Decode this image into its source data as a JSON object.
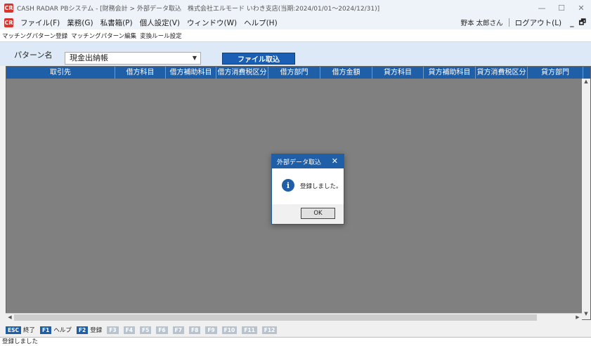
{
  "window": {
    "title": "CASH RADAR PBシステム - [財務会計 > 外部データ取込　株式会社エルモード いわき支店(当期:2024/01/01～2024/12/31)]",
    "logo": "CR",
    "controls": {
      "minimize": "—",
      "maximize": "☐",
      "close": "✕"
    }
  },
  "menu": {
    "items": [
      "ファイル(F)",
      "業務(G)",
      "私書箱(P)",
      "個人設定(V)",
      "ウィンドウ(W)",
      "ヘルプ(H)"
    ],
    "user": "野本 太郎さん",
    "logout": "ログアウト(L)",
    "mdi": {
      "minimize": "_",
      "restore": "🗗"
    }
  },
  "subtabs": [
    "マッチングパターン登録",
    "マッチングパターン編集",
    "変換ルール設定"
  ],
  "pattern": {
    "label": "パターン名",
    "selected": "現金出納帳",
    "import_button": "ファイル取込"
  },
  "grid": {
    "columns": [
      "取引先",
      "借方科目",
      "借方補助科目",
      "借方消費税区分",
      "借方部門",
      "借方金額",
      "貸方科目",
      "貸方補助科目",
      "貸方消費税区分",
      "貸方部門"
    ]
  },
  "dialog": {
    "title": "外部データ取込",
    "message": "登録しました。",
    "ok": "OK"
  },
  "fkeys": [
    {
      "key": "ESC",
      "label": "終了",
      "active": true
    },
    {
      "key": "F1",
      "label": "ヘルプ",
      "active": true
    },
    {
      "key": "F2",
      "label": "登録",
      "active": true
    },
    {
      "key": "F3",
      "label": "",
      "active": false
    },
    {
      "key": "F4",
      "label": "",
      "active": false
    },
    {
      "key": "F5",
      "label": "",
      "active": false
    },
    {
      "key": "F6",
      "label": "",
      "active": false
    },
    {
      "key": "F7",
      "label": "",
      "active": false
    },
    {
      "key": "F8",
      "label": "",
      "active": false
    },
    {
      "key": "F9",
      "label": "",
      "active": false
    },
    {
      "key": "F10",
      "label": "",
      "active": false
    },
    {
      "key": "F11",
      "label": "",
      "active": false
    },
    {
      "key": "F12",
      "label": "",
      "active": false
    }
  ],
  "status": "登録しました",
  "colors": {
    "accent": "#1f5fa8",
    "logo": "#d9352f",
    "grid_bg": "#808080"
  }
}
